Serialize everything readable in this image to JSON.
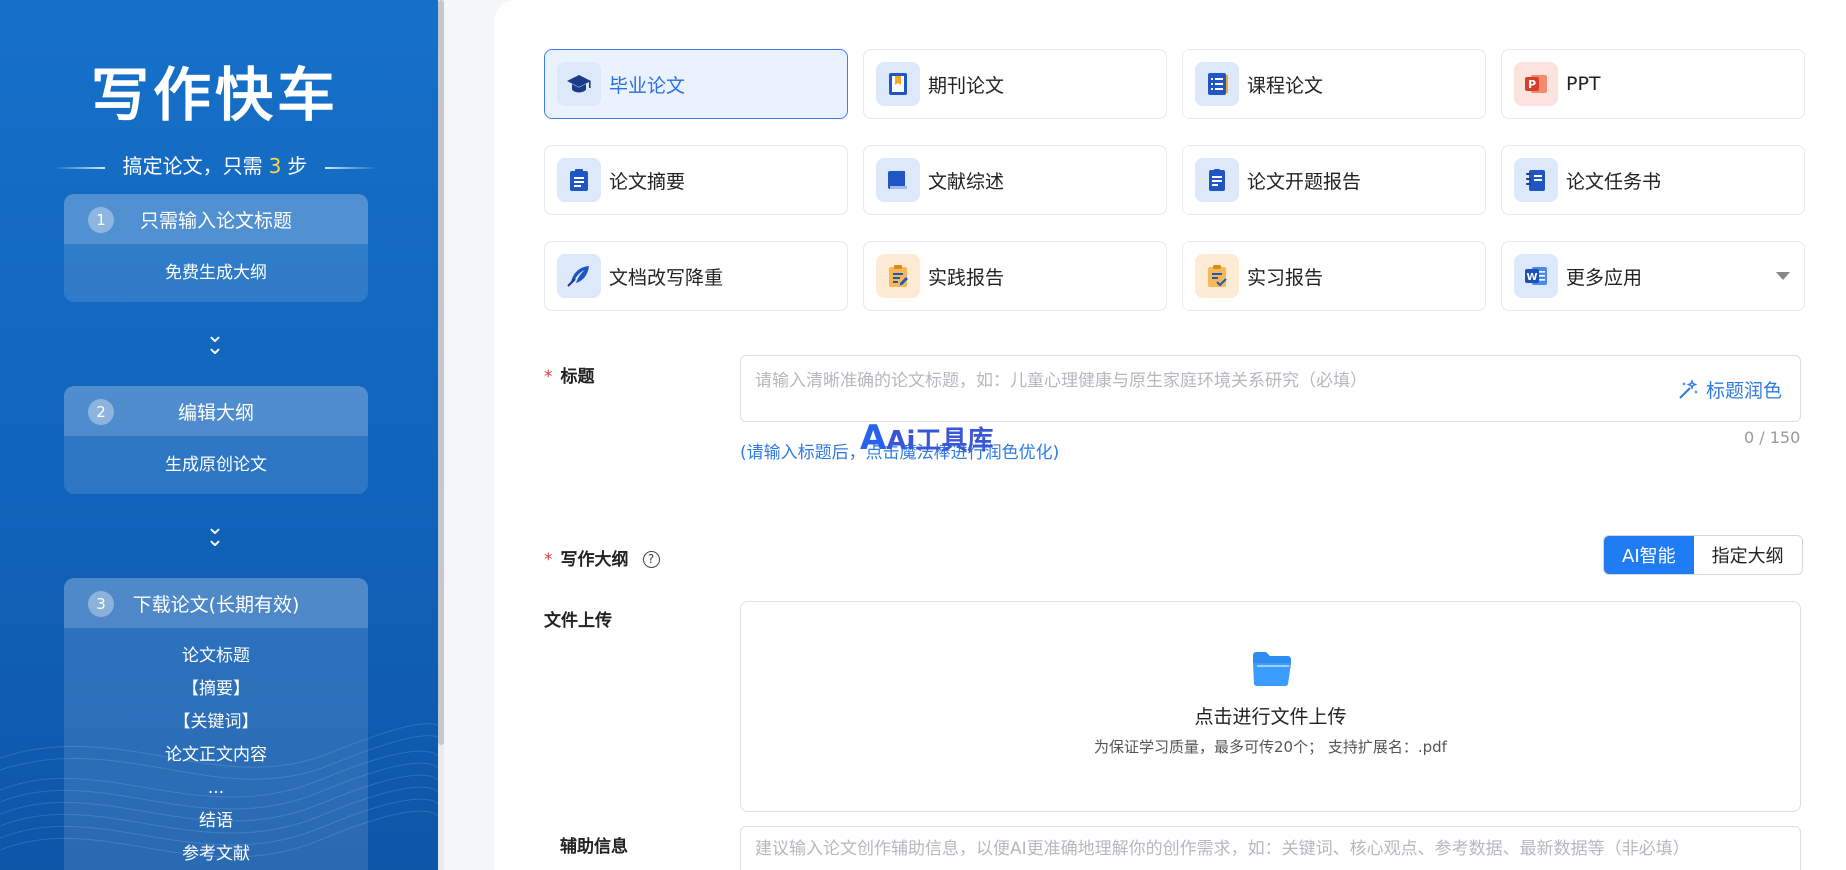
{
  "sidebar": {
    "logo": "写作快车",
    "tagline_prefix": "搞定论文，只需",
    "tagline_num": "3",
    "tagline_suffix": "步",
    "steps": [
      {
        "num": "1",
        "title": "只需输入论文标题",
        "items": [
          "免费生成大纲"
        ]
      },
      {
        "num": "2",
        "title": "编辑大纲",
        "items": [
          "生成原创论文"
        ]
      },
      {
        "num": "3",
        "title": "下载论文(长期有效)",
        "items": [
          "论文标题",
          "【摘要】",
          "【关键词】",
          "论文正文内容",
          "...",
          "结语",
          "参考文献"
        ]
      }
    ]
  },
  "apps": [
    {
      "label": "毕业论文",
      "icon": "graduation-cap-icon",
      "active": true
    },
    {
      "label": "期刊论文",
      "icon": "journal-bookmark-icon"
    },
    {
      "label": "课程论文",
      "icon": "list-document-icon"
    },
    {
      "label": "PPT",
      "icon": "powerpoint-icon"
    },
    {
      "label": "论文摘要",
      "icon": "clipboard-list-icon"
    },
    {
      "label": "文献综述",
      "icon": "book-icon"
    },
    {
      "label": "论文开题报告",
      "icon": "report-document-icon"
    },
    {
      "label": "论文任务书",
      "icon": "notebook-icon"
    },
    {
      "label": "文档改写降重",
      "icon": "feather-pen-icon"
    },
    {
      "label": "实践报告",
      "icon": "clipboard-edit-icon"
    },
    {
      "label": "实习报告",
      "icon": "clipboard-check-icon"
    },
    {
      "label": "更多应用",
      "icon": "word-icon"
    }
  ],
  "form": {
    "title_label": "标题",
    "title_placeholder": "请输入清晰准确的论文标题，如：儿童心理健康与原生家庭环境关系研究（必填）",
    "polish_label": "标题润色",
    "counter": "0 / 150",
    "hint": "(请输入标题后，点击魔法棒进行润色优化)",
    "watermark_a": "A",
    "watermark_text": "Ai工具库",
    "outline_label": "写作大纲",
    "outline_help": "?",
    "mode_ai": "AI智能",
    "mode_custom": "指定大纲",
    "upload_label": "文件上传",
    "upload_title": "点击进行文件上传",
    "upload_sub": "为保证学习质量，最多可传20个； 支持扩展名：.pdf",
    "aux_label": "辅助信息",
    "aux_placeholder": "建议输入论文创作辅助信息，以便AI更准确地理解你的创作需求，如：关键词、核心观点、参考数据、最新数据等（非必填）"
  },
  "colors": {
    "sidebar": "#1468c3",
    "accent": "#1f7cf3",
    "required": "#e0393e"
  }
}
